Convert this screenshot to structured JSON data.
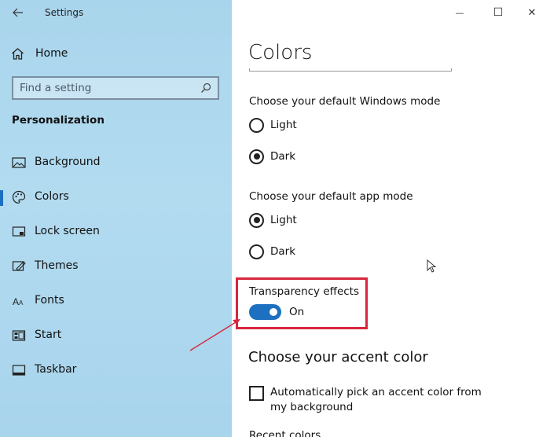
{
  "window": {
    "title": "Settings",
    "minimize_glyph": "—",
    "maximize_glyph": "☐",
    "close_glyph": "✕"
  },
  "sidebar": {
    "home_label": "Home",
    "search_placeholder": "Find a setting",
    "section_title": "Personalization",
    "items": [
      {
        "label": "Background",
        "icon": "image-icon"
      },
      {
        "label": "Colors",
        "icon": "palette-icon",
        "selected": true
      },
      {
        "label": "Lock screen",
        "icon": "lock-screen-icon"
      },
      {
        "label": "Themes",
        "icon": "themes-icon"
      },
      {
        "label": "Fonts",
        "icon": "fonts-icon"
      },
      {
        "label": "Start",
        "icon": "start-icon"
      },
      {
        "label": "Taskbar",
        "icon": "taskbar-icon"
      }
    ]
  },
  "content": {
    "page_title": "Colors",
    "windows_mode": {
      "label": "Choose your default Windows mode",
      "options": [
        "Light",
        "Dark"
      ],
      "selected": "Dark"
    },
    "app_mode": {
      "label": "Choose your default app mode",
      "options": [
        "Light",
        "Dark"
      ],
      "selected": "Light"
    },
    "transparency": {
      "label": "Transparency effects",
      "state_label": "On"
    },
    "accent": {
      "heading": "Choose your accent color",
      "auto_pick_label": "Automatically pick an accent color from my background",
      "recent_label": "Recent colors"
    }
  },
  "colors": {
    "accent": "#1d6fc0",
    "highlight": "#d7263d"
  }
}
